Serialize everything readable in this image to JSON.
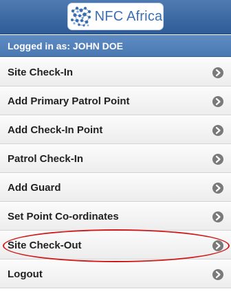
{
  "header": {
    "logo_text": "NFC Africa",
    "logo_icon": "nfc-africa-logo"
  },
  "session": {
    "logged_in_label": "Logged in as: JOHN DOE"
  },
  "menu": {
    "items": [
      {
        "label": "Site Check-In",
        "icon": "chevron-right-icon"
      },
      {
        "label": "Add Primary Patrol Point",
        "icon": "chevron-right-icon"
      },
      {
        "label": "Add Check-In Point",
        "icon": "chevron-right-icon"
      },
      {
        "label": "Patrol Check-In",
        "icon": "chevron-right-icon"
      },
      {
        "label": "Add Guard",
        "icon": "chevron-right-icon"
      },
      {
        "label": "Set Point Co-ordinates",
        "icon": "chevron-right-icon"
      },
      {
        "label": "Site Check-Out",
        "icon": "chevron-right-icon"
      },
      {
        "label": "Logout",
        "icon": "chevron-right-icon"
      }
    ]
  },
  "colors": {
    "header": "#2f5c97",
    "login_bar": "#4a78b2",
    "highlight": "#d01a1a"
  }
}
